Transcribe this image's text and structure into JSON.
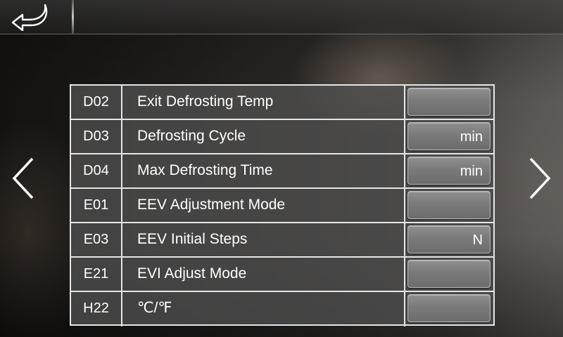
{
  "header": {
    "back_icon": "back-arrow-icon"
  },
  "navigation": {
    "prev_icon": "chevron-left-icon",
    "next_icon": "chevron-right-icon"
  },
  "parameters": [
    {
      "code": "D02",
      "name": "Exit Defrosting Temp",
      "value": "",
      "unit": ""
    },
    {
      "code": "D03",
      "name": "Defrosting Cycle",
      "value": "",
      "unit": "min"
    },
    {
      "code": "D04",
      "name": "Max Defrosting Time",
      "value": "",
      "unit": "min"
    },
    {
      "code": "E01",
      "name": "EEV Adjustment Mode",
      "value": "",
      "unit": ""
    },
    {
      "code": "E03",
      "name": "EEV Initial Steps",
      "value": "",
      "unit": "N"
    },
    {
      "code": "E21",
      "name": "EVI Adjust Mode",
      "value": "",
      "unit": ""
    },
    {
      "code": "H22",
      "name": "℃/℉",
      "value": "",
      "unit": ""
    }
  ],
  "colors": {
    "table_border": "#e6e6e6",
    "text": "#ffffff",
    "button_fill": "#7a7a7a"
  }
}
